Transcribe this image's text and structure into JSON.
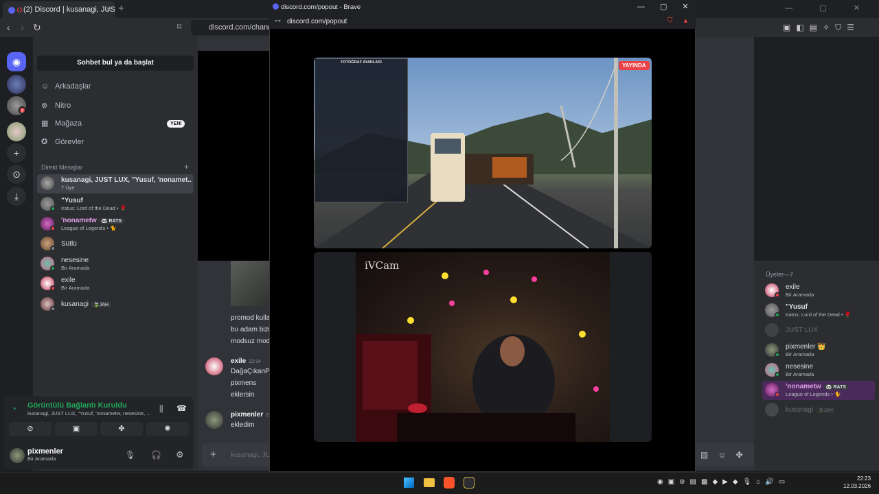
{
  "browser": {
    "tab_title": "(2) Discord | kusanagi, JUST L",
    "url": "discord.com/channel"
  },
  "dm_panel": {
    "search_label": "Sohbet bul ya da başlat",
    "nav": [
      {
        "label": "Arkadaşlar",
        "icon": "friends-icon"
      },
      {
        "label": "Nitro",
        "icon": "nitro-icon"
      },
      {
        "label": "Mağaza",
        "icon": "shop-icon"
      },
      {
        "label": "Görevler",
        "icon": "quests-icon"
      }
    ],
    "new_badge": "YENİ",
    "dm_header": "Direkt Mesajlar",
    "dms": [
      {
        "name": "kusanagi, JUST LUX, \"Yusuf, 'nonamet...",
        "sub": "7 Üye"
      },
      {
        "name": "\"Yusuf",
        "sub": "Iratus: Lord of the Dead • 🌹"
      },
      {
        "name": "'nonametw",
        "tag": "🐼 RATS",
        "sub": "League of Legends • 🐈"
      },
      {
        "name": "Sütlü",
        "sub": ""
      },
      {
        "name": "nesesine",
        "sub": "Bir Aramada"
      },
      {
        "name": "exile",
        "sub": "Bir Aramada"
      },
      {
        "name": "kusanagi",
        "tag": "🍃JAH",
        "sub": ""
      }
    ],
    "voice": {
      "title": "Görüntülü Bağlantı Kuruldu",
      "sub": "kusanagi, JUST LUX, \"Yusuf, 'nonametw, nesesine, ..."
    },
    "user": {
      "name": "pixmenler",
      "status": "Bir Aramada"
    }
  },
  "chat": {
    "lines": [
      "promod kulla",
      "bu adam bizi",
      "modsuz mod"
    ],
    "messages": [
      {
        "author": "exile",
        "time": "22:14",
        "lines": [
          "DağaÇıkanP",
          "pixmens",
          "eklersin"
        ]
      },
      {
        "author": "pixmenler",
        "time": "2",
        "lines": [
          "ekledim"
        ]
      }
    ],
    "input_placeholder": "kusanagi, JU"
  },
  "members": {
    "header": "Üyeler—7",
    "list": [
      {
        "name": "exile",
        "sub": "Bir Aramada"
      },
      {
        "name": "\"Yusuf",
        "sub": "Iratus: Lord of the Dead • 🌹"
      },
      {
        "name": "JUST LUX",
        "sub": ""
      },
      {
        "name": "pixmenler 👑",
        "sub": "Bir Aramada"
      },
      {
        "name": "nesesine",
        "sub": "Bir Aramada"
      },
      {
        "name": "'nonametw",
        "tag": "🐼 RATS",
        "sub": "League of Legends • 🐈"
      },
      {
        "name": "kusanagi",
        "tag": "🍃JAH",
        "sub": ""
      }
    ]
  },
  "popout": {
    "title": "discord.com/popout - Brave",
    "url": "discord.com/popout",
    "live_badge": "YAYINDA",
    "game_menu_title": "FOTOĞRAF AYARLARI",
    "camera_label": "iVCam"
  },
  "taskbar": {
    "time": "22:23",
    "date": "12.03.2026"
  },
  "colors": {
    "accent": "#5865f2",
    "online": "#23a55a",
    "dnd": "#f23f43",
    "live": "#ed4245"
  }
}
